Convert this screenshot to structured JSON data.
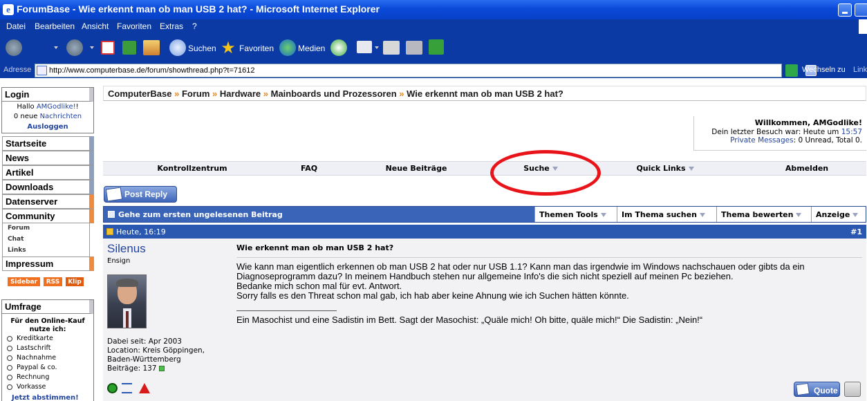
{
  "window": {
    "title": "ForumBase - Wie erkennt man ob man USB 2 hat? - Microsoft Internet Explorer"
  },
  "menu": [
    "Datei",
    "Bearbeiten",
    "Ansicht",
    "Favoriten",
    "Extras",
    "?"
  ],
  "toolbar": {
    "search": "Suchen",
    "favorites": "Favoriten",
    "media": "Medien"
  },
  "address": {
    "label": "Adresse",
    "url": "http://www.computerbase.de/forum/showthread.php?t=71612",
    "go": "Wechseln zu",
    "links": "Links"
  },
  "sidebar": {
    "login": {
      "title": "Login",
      "hello": "Hallo",
      "user": "AMGodlike!",
      "hello_end": "!",
      "new": "0 neue",
      "msgs": "Nachrichten",
      "logout": "Ausloggen"
    },
    "nav": [
      "Startseite",
      "News",
      "Artikel",
      "Downloads",
      "Datenserver",
      "Community"
    ],
    "community_sub": [
      "Forum",
      "Chat",
      "Links"
    ],
    "impressum": "Impressum",
    "tags": [
      "Sidebar",
      "RSS",
      "Klip"
    ],
    "poll": {
      "title": "Umfrage",
      "question": "Für den Online-Kauf nutze ich:",
      "options": [
        "Kreditkarte",
        "Lastschrift",
        "Nachnahme",
        "Paypal & co.",
        "Rechnung",
        "Vorkasse"
      ],
      "vote": "Jetzt abstimmen!"
    }
  },
  "breadcrumb": {
    "items": [
      "ComputerBase",
      "Forum",
      "Hardware",
      "Mainboards und Prozessoren",
      "Wie erkennt man ob man USB 2 hat?"
    ],
    "sep": "»"
  },
  "welcome": {
    "greeting": "Willkommen, AMGodlike!",
    "last_visit": "Dein letzter Besuch war: Heute um",
    "time": "15:57",
    "pm": "Private Messages",
    "pm_stats": ": 0 Unread, Total 0."
  },
  "navbar": [
    "Kontrollzentrum",
    "FAQ",
    "Neue Beiträge",
    "Suche",
    "Quick Links",
    "Abmelden"
  ],
  "buttons": {
    "post_reply": "Post Reply",
    "quote": "Quote"
  },
  "threadbar": {
    "first_unread": "Gehe zum ersten ungelesenen Beitrag",
    "tools": [
      "Themen Tools",
      "Im Thema suchen",
      "Thema bewerten",
      "Anzeige"
    ]
  },
  "post": {
    "date": "Heute, 16:19",
    "number": "#1",
    "user": "Silenus",
    "rank": "Ensign",
    "joined": "Dabei seit: Apr 2003",
    "location": "Location: Kreis Göppingen,",
    "location2": "Baden-Württemberg",
    "posts": "Beiträge: 137",
    "title": "Wie erkennt man ob man USB 2 hat?",
    "body": [
      "Wie kann man eigentlich erkennen ob man USB 2 hat oder nur USB 1.1? Kann man das irgendwie im Windows nachschauen oder gibts da ein",
      "Diagnoseprogramm dazu? In meinem Handbuch stehen nur allgemeine Info's die sich nicht speziell auf meinen Pc beziehen.",
      "Bedanke mich schon mal für evt. Antwort.",
      "Sorry falls es den Threat schon mal gab, ich hab aber keine Ahnung wie ich Suchen hätten könnte."
    ],
    "signature": "Ein Masochist und eine Sadistin im Bett. Sagt der Masochist: „Quäle mich! Oh bitte, quäle mich!“ Die Sadistin: „Nein!“"
  },
  "icons": {
    "app": "ie-icon",
    "search": "search-icon",
    "favorites": "star-icon",
    "media": "globe-icon"
  },
  "colors": {
    "accent": "#2a58b0",
    "highlight": "#e8141a",
    "sidebar_orange": "#f08a3c"
  }
}
